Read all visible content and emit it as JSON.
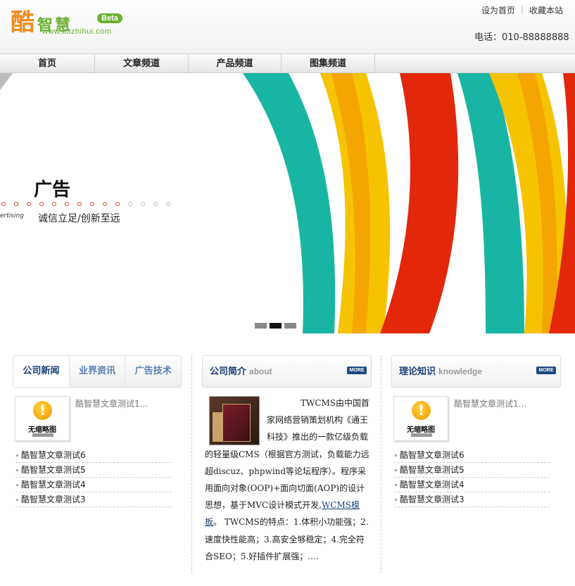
{
  "header": {
    "logo_primary": "酷",
    "logo_secondary": "智慧",
    "logo_beta": "Beta",
    "logo_url": "www.kuzhihui.com",
    "toplinks": [
      "设为首页",
      "收藏本站"
    ],
    "phone": "电话：010-88888888"
  },
  "nav": {
    "items": [
      "首页",
      "文章频道",
      "产品频道",
      "图集频道"
    ]
  },
  "banner": {
    "title": "广告",
    "slogan": "诚信立足/创新至远",
    "tag": "ertising",
    "slides_total": 3,
    "slide_active": 2,
    "colors": {
      "teal": "#19b5a4",
      "yellow": "#f6c300",
      "orange": "#f39a00",
      "red": "#e3270b"
    }
  },
  "col1": {
    "tabs": [
      "公司新闻",
      "业界资讯",
      "广告技术"
    ],
    "active_tab": 0,
    "feature_title": "酷智慧文章测试1...",
    "thumb_text": "无缩略图",
    "list": [
      "酷智慧文章测试6",
      "酷智慧文章测试5",
      "酷智慧文章测试4",
      "酷智慧文章测试3"
    ]
  },
  "col2": {
    "title": "公司简介",
    "title_en": "about",
    "more": "MORE",
    "text_part1": "TWCMS由中国首家网络营销策划机构《通王科技》推出的一款亿级负载的轻量级CMS（根据官方测试，负载能力远超discuz、phpwind等论坛程序）。程序采用面向对象(OOP)+面向切面(AOP)的设计思想，基于MVC设计模式开发,",
    "link": "WCMS模板",
    "text_part2": "。 TWCMS的特点：1.体积小功能强；2.速度快性能高；3.高安全够稳定；4.完全符合SEO；5.好插件扩展强；...."
  },
  "col3": {
    "title": "理论知识",
    "title_en": "knowledge",
    "more": "MORE",
    "feature_title": "酷智慧文章测试1...",
    "thumb_text": "无缩略图",
    "list": [
      "酷智慧文章测试6",
      "酷智慧文章测试5",
      "酷智慧文章测试4",
      "酷智慧文章测试3"
    ]
  }
}
